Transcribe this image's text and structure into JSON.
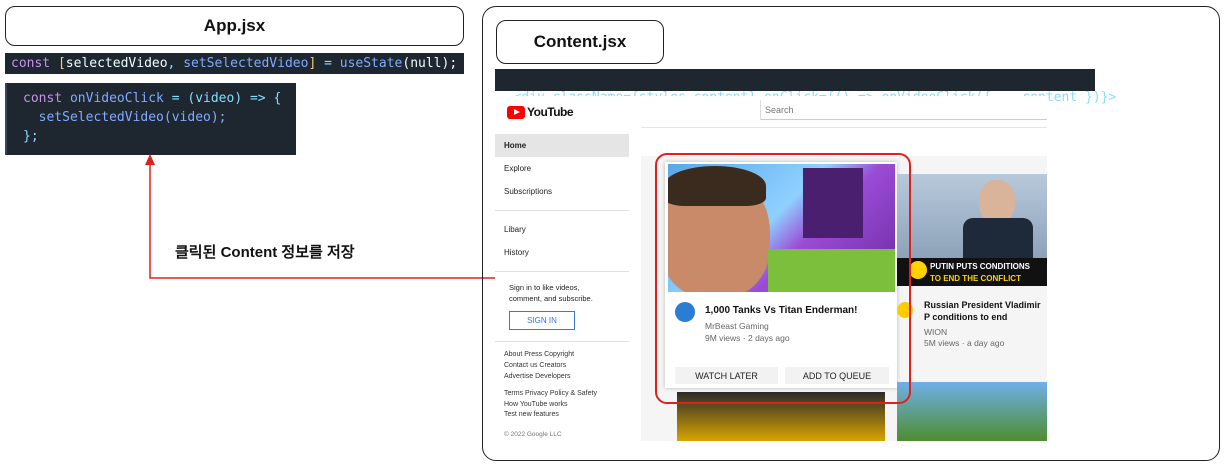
{
  "left": {
    "title": "App.jsx",
    "state_line": {
      "const": "const",
      "lbracket": "[",
      "var1": "selectedVideo",
      "comma": ",",
      "var2": "setSelectedVideo",
      "rbracket": "]",
      "eq": "=",
      "fn": "useState",
      "arg": "(null);"
    },
    "handler": {
      "line1_const": "const",
      "line1_name": "onVideoClick",
      "line1_rest": "= (video) => {",
      "line2": "setSelectedVideo(video);",
      "line3": "};"
    },
    "annotation": "클릭된 Content 정보를 저장"
  },
  "right": {
    "title": "Content.jsx",
    "jsx_line": "<div className={styles.content} onClick={() => onVideoClick({ ...content })}>"
  },
  "youtube": {
    "logo_text": "YouTube",
    "search_placeholder": "Search",
    "sidebar": [
      "Home",
      "Explore",
      "Subscriptions",
      "Libary",
      "History"
    ],
    "signin_text": "Sign in to like videos, comment, and subscribe.",
    "signin_button": "SIGN IN",
    "footer": [
      "About Press Copyright",
      "Contact us Creators",
      "Advertise Developers",
      "Terms Privacy Policy & Safety",
      "How YouTube works",
      "Test new features"
    ],
    "copyright": "© 2022 Google LLC",
    "videos": [
      {
        "title": "1,000 Tanks Vs Titan Enderman!",
        "channel": "MrBeast Gaming",
        "meta": "9M views · 2 days ago"
      },
      {
        "title": "Russian President Vladimir P conditions to end Moscow's",
        "channel": "WION",
        "meta": "5M views · a day ago",
        "thumb_caption_1": "PUTIN PUTS CONDITIONS",
        "thumb_caption_2": "TO END THE CONFLICT"
      }
    ],
    "card_buttons": [
      "WATCH LATER",
      "ADD TO QUEUE"
    ]
  },
  "colors": {
    "arrow": "#e0201c",
    "highlight": "#e0201c",
    "code_bg": "#1e2630",
    "youtube_red": "#ff0000"
  }
}
